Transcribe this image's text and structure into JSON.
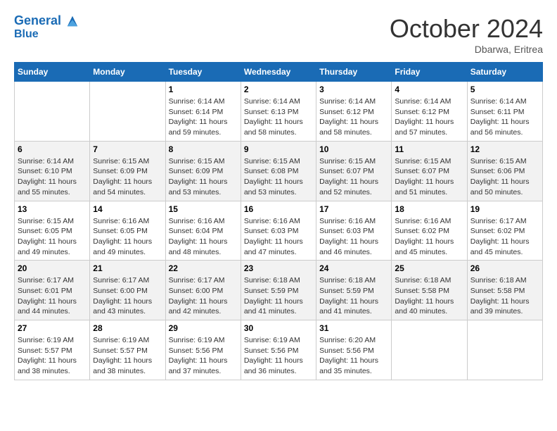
{
  "header": {
    "logo_line1": "General",
    "logo_line2": "Blue",
    "month_title": "October 2024",
    "location": "Dbarwa, Eritrea"
  },
  "days_of_week": [
    "Sunday",
    "Monday",
    "Tuesday",
    "Wednesday",
    "Thursday",
    "Friday",
    "Saturday"
  ],
  "weeks": [
    [
      {
        "num": "",
        "info": ""
      },
      {
        "num": "",
        "info": ""
      },
      {
        "num": "1",
        "info": "Sunrise: 6:14 AM\nSunset: 6:14 PM\nDaylight: 11 hours and 59 minutes."
      },
      {
        "num": "2",
        "info": "Sunrise: 6:14 AM\nSunset: 6:13 PM\nDaylight: 11 hours and 58 minutes."
      },
      {
        "num": "3",
        "info": "Sunrise: 6:14 AM\nSunset: 6:12 PM\nDaylight: 11 hours and 58 minutes."
      },
      {
        "num": "4",
        "info": "Sunrise: 6:14 AM\nSunset: 6:12 PM\nDaylight: 11 hours and 57 minutes."
      },
      {
        "num": "5",
        "info": "Sunrise: 6:14 AM\nSunset: 6:11 PM\nDaylight: 11 hours and 56 minutes."
      }
    ],
    [
      {
        "num": "6",
        "info": "Sunrise: 6:14 AM\nSunset: 6:10 PM\nDaylight: 11 hours and 55 minutes."
      },
      {
        "num": "7",
        "info": "Sunrise: 6:15 AM\nSunset: 6:09 PM\nDaylight: 11 hours and 54 minutes."
      },
      {
        "num": "8",
        "info": "Sunrise: 6:15 AM\nSunset: 6:09 PM\nDaylight: 11 hours and 53 minutes."
      },
      {
        "num": "9",
        "info": "Sunrise: 6:15 AM\nSunset: 6:08 PM\nDaylight: 11 hours and 53 minutes."
      },
      {
        "num": "10",
        "info": "Sunrise: 6:15 AM\nSunset: 6:07 PM\nDaylight: 11 hours and 52 minutes."
      },
      {
        "num": "11",
        "info": "Sunrise: 6:15 AM\nSunset: 6:07 PM\nDaylight: 11 hours and 51 minutes."
      },
      {
        "num": "12",
        "info": "Sunrise: 6:15 AM\nSunset: 6:06 PM\nDaylight: 11 hours and 50 minutes."
      }
    ],
    [
      {
        "num": "13",
        "info": "Sunrise: 6:15 AM\nSunset: 6:05 PM\nDaylight: 11 hours and 49 minutes."
      },
      {
        "num": "14",
        "info": "Sunrise: 6:16 AM\nSunset: 6:05 PM\nDaylight: 11 hours and 49 minutes."
      },
      {
        "num": "15",
        "info": "Sunrise: 6:16 AM\nSunset: 6:04 PM\nDaylight: 11 hours and 48 minutes."
      },
      {
        "num": "16",
        "info": "Sunrise: 6:16 AM\nSunset: 6:03 PM\nDaylight: 11 hours and 47 minutes."
      },
      {
        "num": "17",
        "info": "Sunrise: 6:16 AM\nSunset: 6:03 PM\nDaylight: 11 hours and 46 minutes."
      },
      {
        "num": "18",
        "info": "Sunrise: 6:16 AM\nSunset: 6:02 PM\nDaylight: 11 hours and 45 minutes."
      },
      {
        "num": "19",
        "info": "Sunrise: 6:17 AM\nSunset: 6:02 PM\nDaylight: 11 hours and 45 minutes."
      }
    ],
    [
      {
        "num": "20",
        "info": "Sunrise: 6:17 AM\nSunset: 6:01 PM\nDaylight: 11 hours and 44 minutes."
      },
      {
        "num": "21",
        "info": "Sunrise: 6:17 AM\nSunset: 6:00 PM\nDaylight: 11 hours and 43 minutes."
      },
      {
        "num": "22",
        "info": "Sunrise: 6:17 AM\nSunset: 6:00 PM\nDaylight: 11 hours and 42 minutes."
      },
      {
        "num": "23",
        "info": "Sunrise: 6:18 AM\nSunset: 5:59 PM\nDaylight: 11 hours and 41 minutes."
      },
      {
        "num": "24",
        "info": "Sunrise: 6:18 AM\nSunset: 5:59 PM\nDaylight: 11 hours and 41 minutes."
      },
      {
        "num": "25",
        "info": "Sunrise: 6:18 AM\nSunset: 5:58 PM\nDaylight: 11 hours and 40 minutes."
      },
      {
        "num": "26",
        "info": "Sunrise: 6:18 AM\nSunset: 5:58 PM\nDaylight: 11 hours and 39 minutes."
      }
    ],
    [
      {
        "num": "27",
        "info": "Sunrise: 6:19 AM\nSunset: 5:57 PM\nDaylight: 11 hours and 38 minutes."
      },
      {
        "num": "28",
        "info": "Sunrise: 6:19 AM\nSunset: 5:57 PM\nDaylight: 11 hours and 38 minutes."
      },
      {
        "num": "29",
        "info": "Sunrise: 6:19 AM\nSunset: 5:56 PM\nDaylight: 11 hours and 37 minutes."
      },
      {
        "num": "30",
        "info": "Sunrise: 6:19 AM\nSunset: 5:56 PM\nDaylight: 11 hours and 36 minutes."
      },
      {
        "num": "31",
        "info": "Sunrise: 6:20 AM\nSunset: 5:56 PM\nDaylight: 11 hours and 35 minutes."
      },
      {
        "num": "",
        "info": ""
      },
      {
        "num": "",
        "info": ""
      }
    ]
  ]
}
